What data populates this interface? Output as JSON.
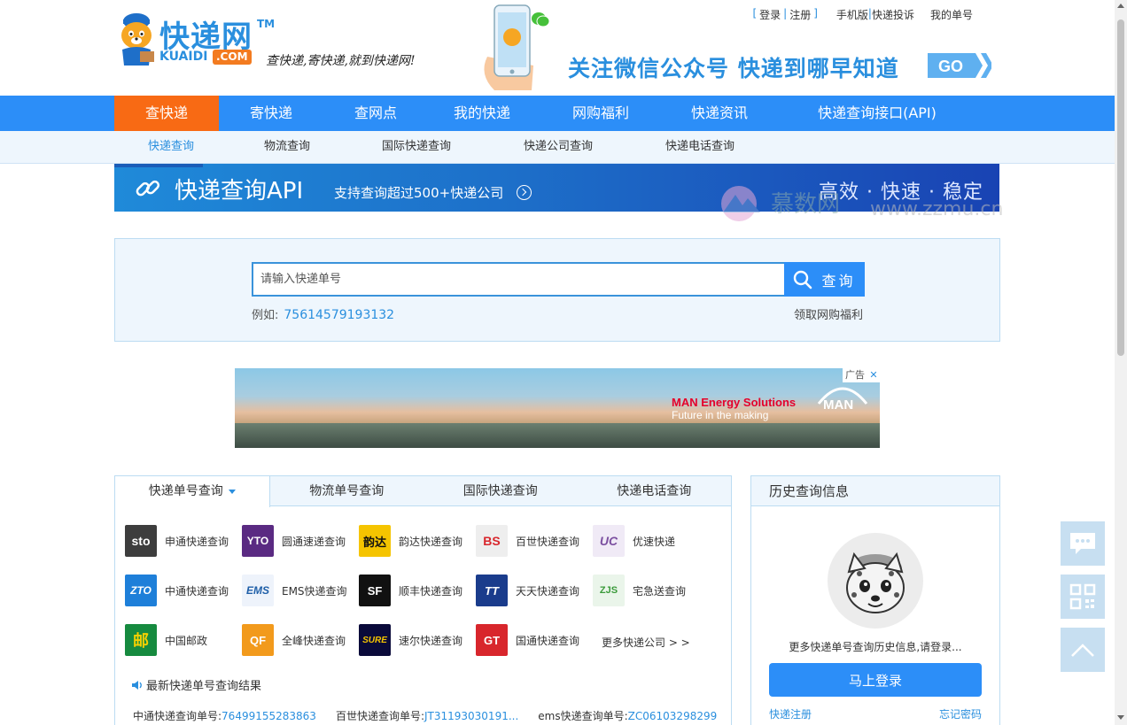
{
  "header": {
    "logo_cn": "快递网",
    "logo_tm": "TM",
    "logo_en": "KUAIDI",
    "logo_com": ".COM",
    "slogan": "查快递,寄快递,就到快递网!",
    "wechat_text": "关注微信公众号 快递到哪早知道",
    "go_label": "GO",
    "top_links": {
      "login": "登录",
      "register": "注册",
      "mobile": "手机版",
      "complaint": "快递投诉",
      "my_orders": "我的单号"
    }
  },
  "nav": {
    "items": [
      {
        "label": "查快递"
      },
      {
        "label": "寄快递"
      },
      {
        "label": "查网点"
      },
      {
        "label": "我的快递"
      },
      {
        "label": "网购福利"
      },
      {
        "label": "快递资讯"
      },
      {
        "label": "快递查询接口(API)"
      }
    ]
  },
  "subnav": {
    "items": [
      {
        "label": "快递查询"
      },
      {
        "label": "物流查询"
      },
      {
        "label": "国际快递查询"
      },
      {
        "label": "快递公司查询"
      },
      {
        "label": "快递电话查询"
      }
    ]
  },
  "api_banner": {
    "title": "快递查询API",
    "subtitle": "支持查询超过500+快递公司",
    "slogan": "高效 · 快速 · 稳定"
  },
  "watermark": {
    "cn": "慕数网",
    "en": "www.zzmu.cn"
  },
  "search": {
    "placeholder": "请输入快递单号",
    "button_label": "查询",
    "example_label": "例如:",
    "example_number": "75614579193132",
    "welfare_link": "领取网购福利"
  },
  "ad": {
    "brand": "MAN Energy Solutions",
    "tagline": "Future in the making",
    "logo_text": "MAN",
    "label": "广告",
    "close": "✕"
  },
  "courier_panel": {
    "tabs": [
      {
        "label": "快递单号查询"
      },
      {
        "label": "物流单号查询"
      },
      {
        "label": "国际快递查询"
      },
      {
        "label": "快递电话查询"
      }
    ],
    "couriers": [
      {
        "name": "申通快递查询",
        "logo": "sto",
        "color": "#3d3d3d"
      },
      {
        "name": "圆通速递查询",
        "logo": "YTO",
        "color": "#5a2a82"
      },
      {
        "name": "韵达快递查询",
        "logo": "韵达",
        "color": "#f5c400"
      },
      {
        "name": "百世快递查询",
        "logo": "BS",
        "color": "#d8262c"
      },
      {
        "name": "优速快递",
        "logo": "UC",
        "color": "#7b4fa0"
      },
      {
        "name": "中通快递查询",
        "logo": "ZTO",
        "color": "#1e7fd9"
      },
      {
        "name": "EMS快递查询",
        "logo": "EMS",
        "color": "#1f5fa8"
      },
      {
        "name": "顺丰快递查询",
        "logo": "SF",
        "color": "#111111"
      },
      {
        "name": "天天快递查询",
        "logo": "TT",
        "color": "#1a3c8c"
      },
      {
        "name": "宅急送查询",
        "logo": "ZJS",
        "color": "#3a9a3a"
      },
      {
        "name": "中国邮政",
        "logo": "邮",
        "color": "#168a3f"
      },
      {
        "name": "全峰快递查询",
        "logo": "QF",
        "color": "#f29a1c"
      },
      {
        "name": "速尔快递查询",
        "logo": "SURE",
        "color": "#0a0a3a"
      },
      {
        "name": "国通快递查询",
        "logo": "GT",
        "color": "#d8262c"
      }
    ],
    "more_label": "更多快递公司 > >",
    "latest_label": "最新快递单号查询结果",
    "latest": [
      {
        "prefix": "中通快递查询单号:",
        "number": "76499155283863"
      },
      {
        "prefix": "百世快递查询单号:",
        "number": "JT31193030191..."
      },
      {
        "prefix": "ems快递查询单号:",
        "number": "ZC06103298299"
      }
    ]
  },
  "history": {
    "title": "历史查询信息",
    "text": "更多快递单号查询历史信息,请登录...",
    "login_button": "马上登录",
    "register_link": "快递注册",
    "forgot_link": "忘记密码"
  },
  "colors": {
    "brand_blue": "#2c8ef8",
    "nav_active": "#f86a14",
    "link_blue": "#2a8fde"
  }
}
